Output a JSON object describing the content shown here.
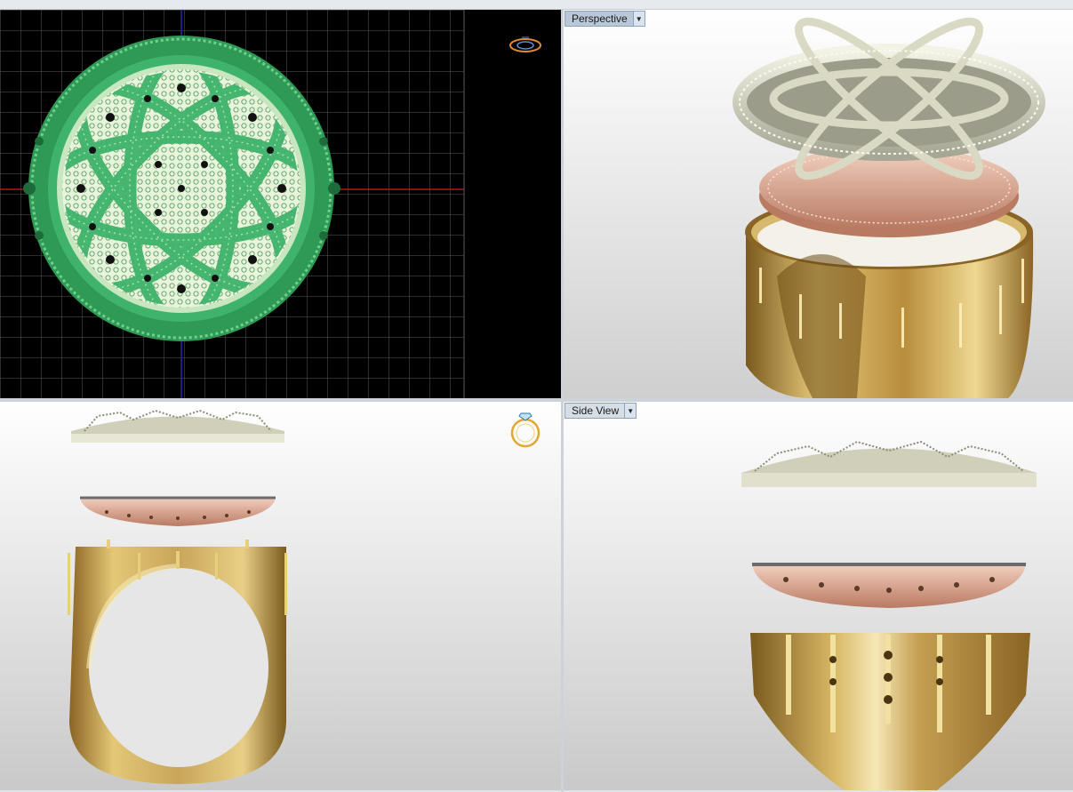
{
  "viewports": {
    "perspective": {
      "label": "Perspective"
    },
    "side": {
      "label": "Side View"
    }
  },
  "icons": {
    "top_view_gizmo": "ring-top-view-icon",
    "front_view_gizmo": "ring-with-diamond-icon",
    "viewport_menu": "triangle-down-icon"
  },
  "colors": {
    "grid_background": "#000000",
    "grid_lines": "#5a5a5a",
    "x_axis": "#b31818",
    "y_axis": "#2424b8",
    "setting_green": "#3fb36b",
    "silver_plate": "#d9d9c4",
    "rose_gold": "#d9a48c",
    "yellow_gold": "#c9a65a",
    "tab_active": "#b9c8d9"
  }
}
